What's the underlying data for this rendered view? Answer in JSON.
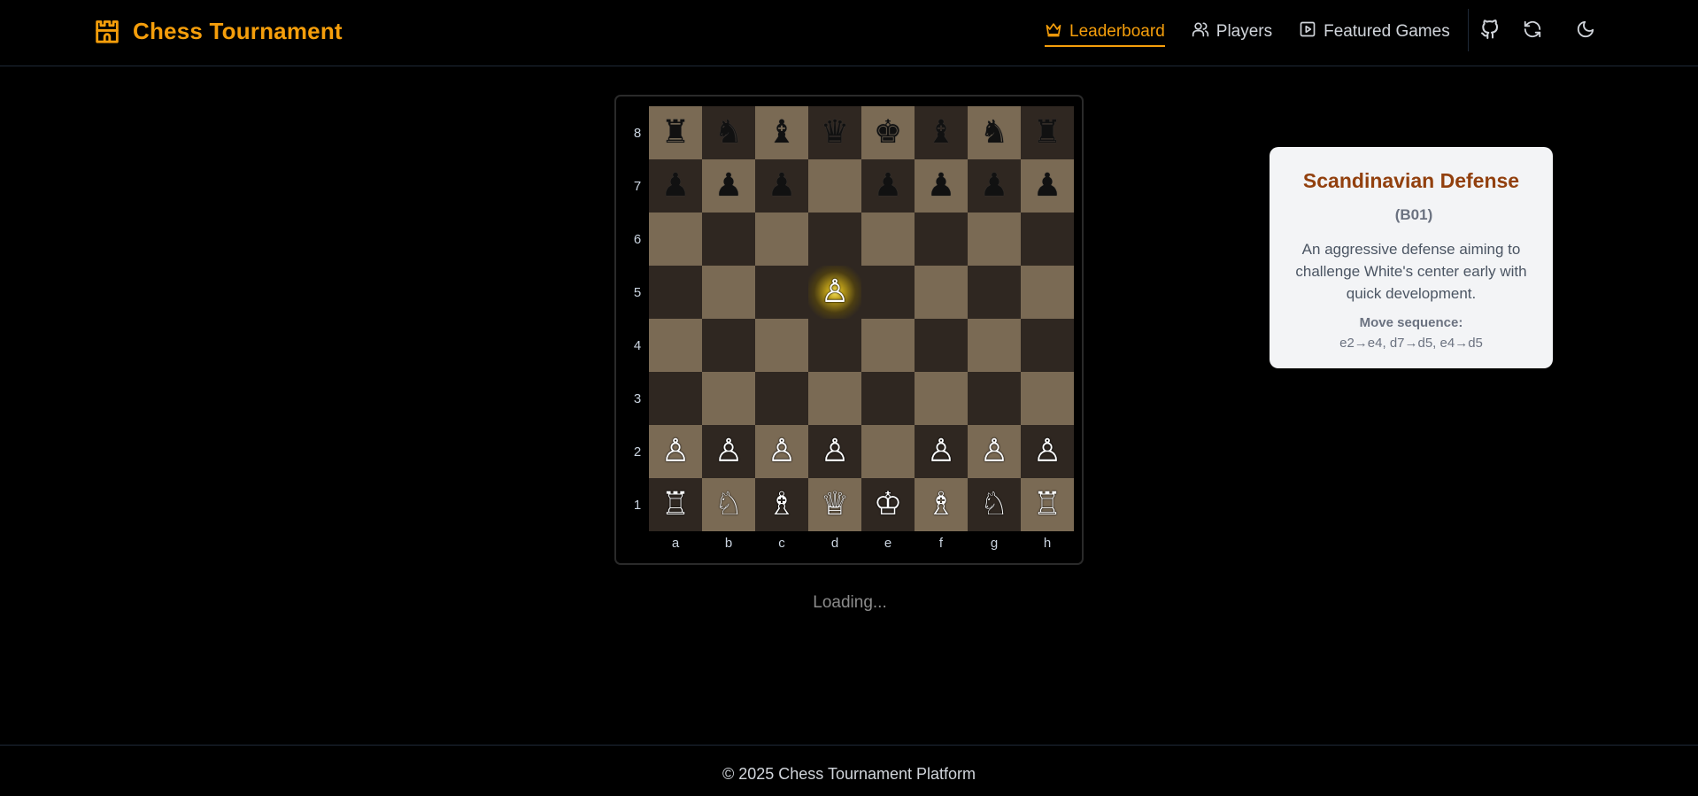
{
  "header": {
    "brand_title": "Chess Tournament",
    "nav": [
      {
        "label": "Leaderboard",
        "icon": "crown-icon",
        "active": true
      },
      {
        "label": "Players",
        "icon": "users-icon",
        "active": false
      },
      {
        "label": "Featured Games",
        "icon": "play-square-icon",
        "active": false
      }
    ],
    "actions": [
      "github-icon",
      "refresh-icon",
      "moon-icon"
    ]
  },
  "board": {
    "ranks": [
      "8",
      "7",
      "6",
      "5",
      "4",
      "3",
      "2",
      "1"
    ],
    "files": [
      "a",
      "b",
      "c",
      "d",
      "e",
      "f",
      "g",
      "h"
    ],
    "rows": [
      [
        "♜",
        "♞",
        "♝",
        "♛",
        "♚",
        "♝",
        "♞",
        "♜"
      ],
      [
        "♟",
        "♟",
        "♟",
        "",
        "♟",
        "♟",
        "♟",
        "♟"
      ],
      [
        "",
        "",
        "",
        "",
        "",
        "",
        "",
        ""
      ],
      [
        "",
        "",
        "",
        "♙",
        "",
        "",
        "",
        ""
      ],
      [
        "",
        "",
        "",
        "",
        "",
        "",
        "",
        ""
      ],
      [
        "",
        "",
        "",
        "",
        "",
        "",
        "",
        ""
      ],
      [
        "♙",
        "♙",
        "♙",
        "♙",
        "",
        "♙",
        "♙",
        "♙"
      ],
      [
        "♖",
        "♘",
        "♗",
        "♕",
        "♔",
        "♗",
        "♘",
        "♖"
      ]
    ],
    "highlight_square": "d5",
    "light_color": "#7a6a54",
    "dark_color": "#2f2721"
  },
  "status": {
    "loading_text": "Loading..."
  },
  "opening": {
    "name": "Scandinavian Defense",
    "eco": "(B01)",
    "description": "An aggressive defense aiming to challenge White's center early with quick development.",
    "sequence_label": "Move sequence:",
    "sequence": "e2→e4, d7→d5, e4→d5"
  },
  "footer": {
    "text": "© 2025 Chess Tournament Platform"
  },
  "colors": {
    "accent": "#f59e0b",
    "opening_title": "#92400e"
  }
}
